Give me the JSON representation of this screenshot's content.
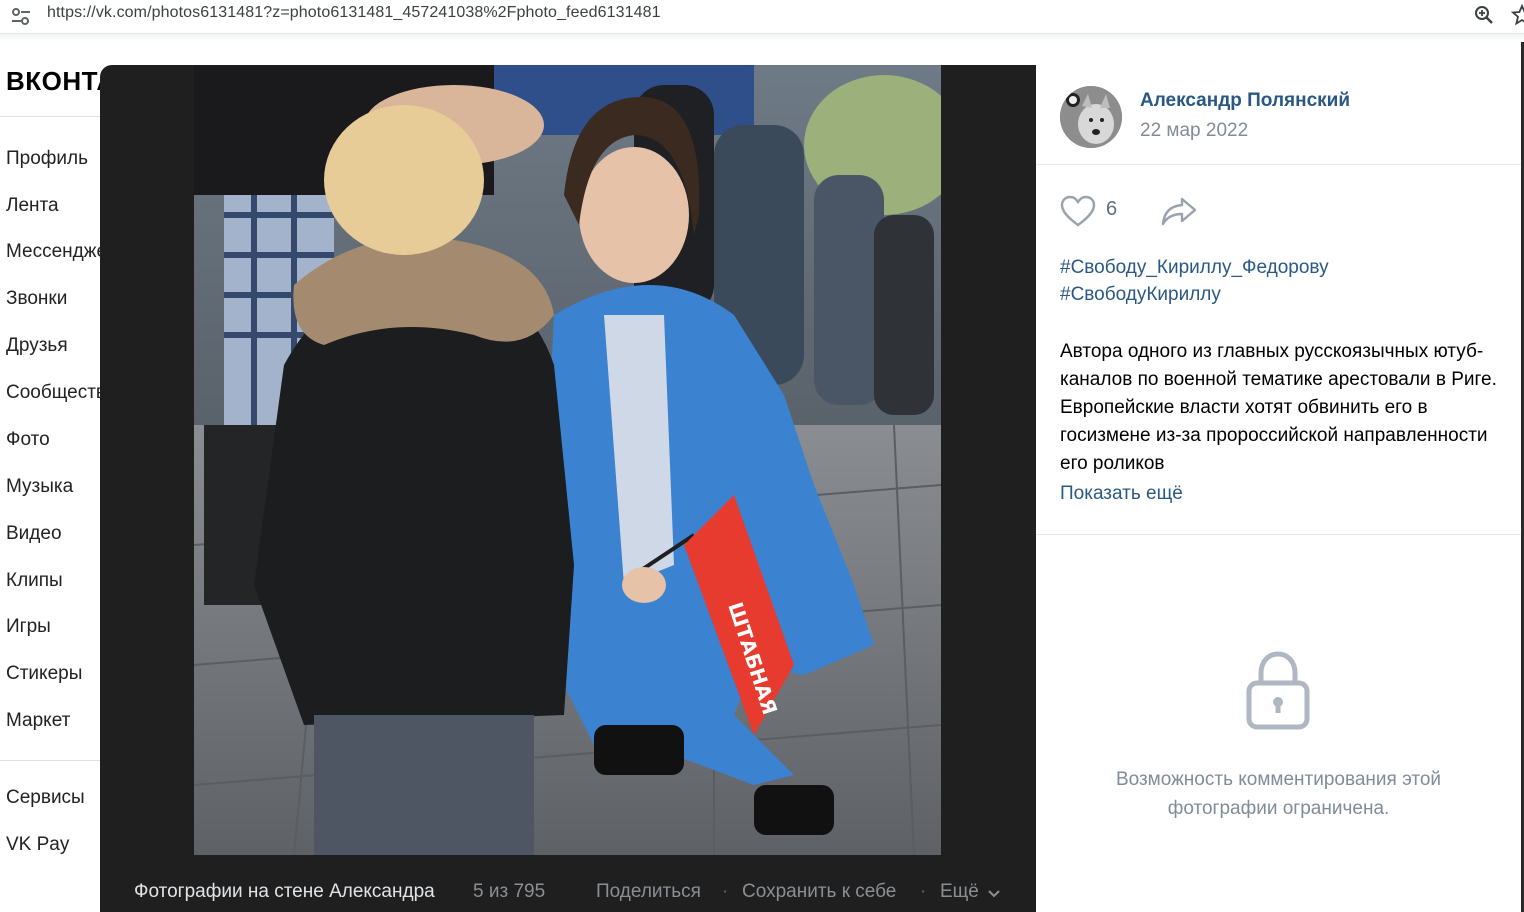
{
  "browser": {
    "url": "https://vk.com/photos6131481?z=photo6131481_457241038%2Fphoto_feed6131481",
    "icons": [
      "tune-icon",
      "zoom-icon",
      "star-icon"
    ]
  },
  "sidebar": {
    "logo": "ВКОНТАКТЕ",
    "items": [
      {
        "label": "Профиль"
      },
      {
        "label": "Лента"
      },
      {
        "label": "Мессенджер"
      },
      {
        "label": "Звонки"
      },
      {
        "label": "Друзья"
      },
      {
        "label": "Сообщества"
      },
      {
        "label": "Фото"
      },
      {
        "label": "Музыка"
      },
      {
        "label": "Видео"
      },
      {
        "label": "Клипы"
      },
      {
        "label": "Игры"
      },
      {
        "label": "Стикеры"
      },
      {
        "label": "Маркет"
      }
    ],
    "extra": [
      {
        "label": "Сервисы"
      },
      {
        "label": "VK Pay"
      }
    ]
  },
  "viewer": {
    "album_title": "Фотографии на стене Александра",
    "counter": "5 из 795",
    "share": "Поделиться",
    "save": "Сохранить к себе",
    "more": "Ещё",
    "separator": "·",
    "flag_text": "ШТАБНАЯ"
  },
  "post": {
    "author": "Александр Полянский",
    "date": "22 мар 2022",
    "likes": "6",
    "tags": [
      "#Свободу_Кириллу_Федорову",
      "#СвободуКириллу"
    ],
    "description": "Автора одного из главных русскоязычных ютуб-каналов по военной тематике арестовали в Риге. Европейские власти хотят обвинить его в госизмене из-за пророссийской направленности его роликов",
    "show_more": "Показать ещё",
    "comments_locked": "Возможность комментирования этой фотографии ограничена."
  },
  "colors": {
    "link": "#2a5885",
    "muted": "#818c99",
    "viewer_bg": "#1f1f1f",
    "flag_red": "#e63b2e"
  }
}
